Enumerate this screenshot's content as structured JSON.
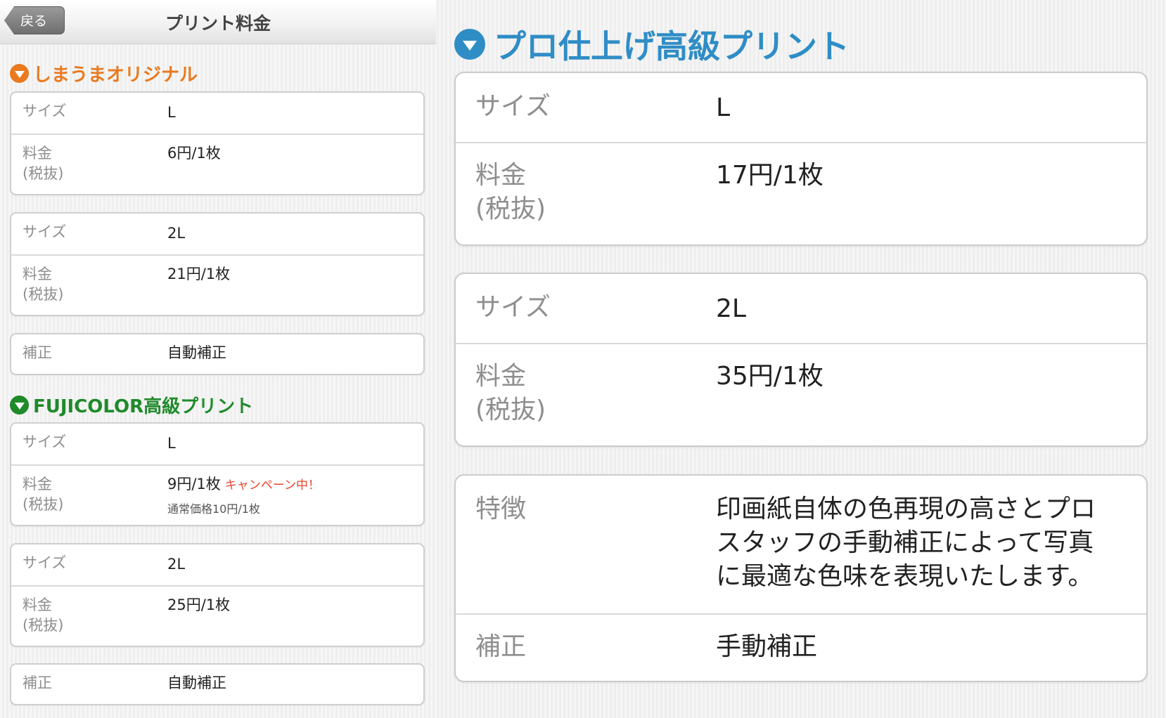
{
  "nav": {
    "back_label": "戻る",
    "title": "プリント料金"
  },
  "colors": {
    "original": "#e97a1f",
    "fujicolor": "#1f8a2a",
    "pro": "#2f8dc6"
  },
  "original": {
    "title": "しまうまオリジナル",
    "sizes": [
      {
        "size_label": "サイズ",
        "size_value": "L",
        "price_label_1": "料金",
        "price_label_2": "(税抜)",
        "price_value": "6円/1枚"
      },
      {
        "size_label": "サイズ",
        "size_value": "2L",
        "price_label_1": "料金",
        "price_label_2": "(税抜)",
        "price_value": "21円/1枚"
      }
    ],
    "correction": {
      "label": "補正",
      "value": "自動補正"
    }
  },
  "fujicolor": {
    "title": "FUJICOLOR高級プリント",
    "sizes": [
      {
        "size_label": "サイズ",
        "size_value": "L",
        "price_label_1": "料金",
        "price_label_2": "(税抜)",
        "price_value": "9円/1枚",
        "campaign": "キャンペーン中！",
        "regular_price": "通常価格10円/1枚"
      },
      {
        "size_label": "サイズ",
        "size_value": "2L",
        "price_label_1": "料金",
        "price_label_2": "(税抜)",
        "price_value": "25円/1枚"
      }
    ],
    "correction": {
      "label": "補正",
      "value": "自動補正"
    }
  },
  "pro": {
    "title": "プロ仕上げ高級プリント",
    "sizes": [
      {
        "size_label": "サイズ",
        "size_value": "L",
        "price_label_1": "料金",
        "price_label_2": "(税抜)",
        "price_value": "17円/1枚"
      },
      {
        "size_label": "サイズ",
        "size_value": "2L",
        "price_label_1": "料金",
        "price_label_2": "(税抜)",
        "price_value": "35円/1枚"
      }
    ],
    "feature": {
      "label": "特徴",
      "line_1": "印画紙自体の色再現の高さとプロ",
      "line_2": "スタッフの手動補正によって写真",
      "line_3": "に最適な色味を表現いたします。"
    },
    "correction": {
      "label": "補正",
      "value": "手動補正"
    }
  }
}
